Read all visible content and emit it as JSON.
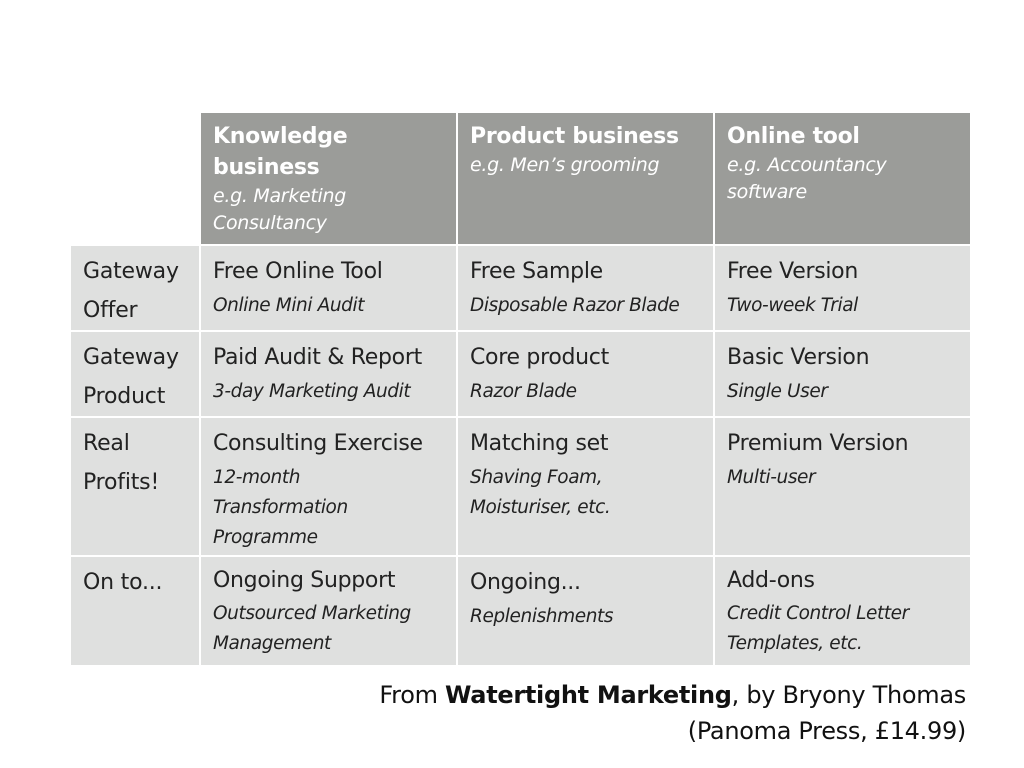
{
  "table": {
    "columns": [
      {
        "title": "Knowledge business",
        "subtitle": "e.g. Marketing Consultancy"
      },
      {
        "title": "Product business",
        "subtitle": "e.g. Men’s grooming"
      },
      {
        "title": "Online tool",
        "subtitle": "e.g. Accountancy software"
      }
    ],
    "rows": [
      {
        "label": "Gateway Offer",
        "cells": [
          {
            "main": "Free Online Tool",
            "detail": "Online Mini Audit"
          },
          {
            "main": "Free Sample",
            "detail": "Disposable Razor Blade"
          },
          {
            "main": "Free Version",
            "detail": "Two-week Trial"
          }
        ]
      },
      {
        "label": "Gateway Product",
        "cells": [
          {
            "main": "Paid Audit & Report",
            "detail": "3-day Marketing Audit"
          },
          {
            "main": "Core product",
            "detail": "Razor Blade"
          },
          {
            "main": "Basic Version",
            "detail": "Single User"
          }
        ]
      },
      {
        "label": "Real Profits!",
        "cells": [
          {
            "main": "Consulting Exercise",
            "detail": "12-month Transformation Programme"
          },
          {
            "main": "Matching set",
            "detail": "Shaving Foam, Moisturiser, etc."
          },
          {
            "main": "Premium Version",
            "detail": "Multi-user"
          }
        ]
      },
      {
        "label": "On to...",
        "cells": [
          {
            "main": "Ongoing Support",
            "detail": "Outsourced Marketing Management"
          },
          {
            "main": "Ongoing...",
            "detail": "Replenishments"
          },
          {
            "main": "Add-ons",
            "detail": "Credit Control Letter Templates, etc."
          }
        ]
      }
    ]
  },
  "citation": {
    "prefix": "From ",
    "book_title": "Watertight Marketing",
    "suffix": ", by Bryony Thomas",
    "line2": "(Panoma Press, £14.99)"
  },
  "colors": {
    "header_bg": "#9b9c99",
    "cell_bg": "#dfe0df",
    "header_text": "#ffffff",
    "body_text": "#222222"
  }
}
